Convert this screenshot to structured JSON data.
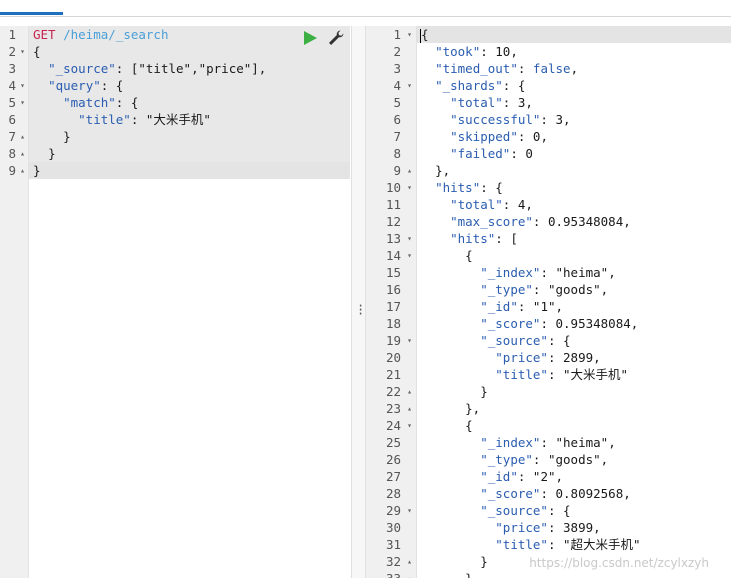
{
  "request": {
    "method": "GET",
    "path": "/heima/_search",
    "lines": [
      {
        "n": "1",
        "fold": "",
        "html": "<span class='m'>GET</span> <span class='u'>/heima/_search</span>"
      },
      {
        "n": "2",
        "fold": "▾",
        "html": "<span class='p'>{</span>"
      },
      {
        "n": "3",
        "fold": "",
        "html": "  <span class='k'>\"_source\"</span><span class='p'>: [</span><span class='s'>\"title\"</span><span class='p'>,</span><span class='s'>\"price\"</span><span class='p'>],</span>"
      },
      {
        "n": "4",
        "fold": "▾",
        "html": "  <span class='k'>\"query\"</span><span class='p'>: {</span>"
      },
      {
        "n": "5",
        "fold": "▾",
        "html": "    <span class='k'>\"match\"</span><span class='p'>: {</span>"
      },
      {
        "n": "6",
        "fold": "",
        "html": "      <span class='k'>\"title\"</span><span class='p'>: </span><span class='s'>\"大米手机\"</span>"
      },
      {
        "n": "7",
        "fold": "▴",
        "html": "    <span class='p'>}</span>"
      },
      {
        "n": "8",
        "fold": "▴",
        "html": "  <span class='p'>}</span>"
      },
      {
        "n": "9",
        "fold": "▴",
        "html": "<span class='p'>}</span>"
      }
    ]
  },
  "response": {
    "lines": [
      {
        "n": "1",
        "fold": "▾",
        "html": "<span class='p'>{</span>"
      },
      {
        "n": "2",
        "fold": "",
        "html": "  <span class='k'>\"took\"</span><span class='p'>: </span><span class='n'>10</span><span class='p'>,</span>"
      },
      {
        "n": "3",
        "fold": "",
        "html": "  <span class='k'>\"timed_out\"</span><span class='p'>: </span><span class='b'>false</span><span class='p'>,</span>"
      },
      {
        "n": "4",
        "fold": "▾",
        "html": "  <span class='k'>\"_shards\"</span><span class='p'>: {</span>"
      },
      {
        "n": "5",
        "fold": "",
        "html": "    <span class='k'>\"total\"</span><span class='p'>: </span><span class='n'>3</span><span class='p'>,</span>"
      },
      {
        "n": "6",
        "fold": "",
        "html": "    <span class='k'>\"successful\"</span><span class='p'>: </span><span class='n'>3</span><span class='p'>,</span>"
      },
      {
        "n": "7",
        "fold": "",
        "html": "    <span class='k'>\"skipped\"</span><span class='p'>: </span><span class='n'>0</span><span class='p'>,</span>"
      },
      {
        "n": "8",
        "fold": "",
        "html": "    <span class='k'>\"failed\"</span><span class='p'>: </span><span class='n'>0</span>"
      },
      {
        "n": "9",
        "fold": "▴",
        "html": "  <span class='p'>},</span>"
      },
      {
        "n": "10",
        "fold": "▾",
        "html": "  <span class='k'>\"hits\"</span><span class='p'>: {</span>"
      },
      {
        "n": "11",
        "fold": "",
        "html": "    <span class='k'>\"total\"</span><span class='p'>: </span><span class='n'>4</span><span class='p'>,</span>"
      },
      {
        "n": "12",
        "fold": "",
        "html": "    <span class='k'>\"max_score\"</span><span class='p'>: </span><span class='n'>0.95348084</span><span class='p'>,</span>"
      },
      {
        "n": "13",
        "fold": "▾",
        "html": "    <span class='k'>\"hits\"</span><span class='p'>: [</span>"
      },
      {
        "n": "14",
        "fold": "▾",
        "html": "      <span class='p'>{</span>"
      },
      {
        "n": "15",
        "fold": "",
        "html": "        <span class='k'>\"_index\"</span><span class='p'>: </span><span class='s'>\"heima\"</span><span class='p'>,</span>"
      },
      {
        "n": "16",
        "fold": "",
        "html": "        <span class='k'>\"_type\"</span><span class='p'>: </span><span class='s'>\"goods\"</span><span class='p'>,</span>"
      },
      {
        "n": "17",
        "fold": "",
        "html": "        <span class='k'>\"_id\"</span><span class='p'>: </span><span class='s'>\"1\"</span><span class='p'>,</span>"
      },
      {
        "n": "18",
        "fold": "",
        "html": "        <span class='k'>\"_score\"</span><span class='p'>: </span><span class='n'>0.95348084</span><span class='p'>,</span>"
      },
      {
        "n": "19",
        "fold": "▾",
        "html": "        <span class='k'>\"_source\"</span><span class='p'>: {</span>"
      },
      {
        "n": "20",
        "fold": "",
        "html": "          <span class='k'>\"price\"</span><span class='p'>: </span><span class='n'>2899</span><span class='p'>,</span>"
      },
      {
        "n": "21",
        "fold": "",
        "html": "          <span class='k'>\"title\"</span><span class='p'>: </span><span class='s'>\"大米手机\"</span>"
      },
      {
        "n": "22",
        "fold": "▴",
        "html": "        <span class='p'>}</span>"
      },
      {
        "n": "23",
        "fold": "▴",
        "html": "      <span class='p'>},</span>"
      },
      {
        "n": "24",
        "fold": "▾",
        "html": "      <span class='p'>{</span>"
      },
      {
        "n": "25",
        "fold": "",
        "html": "        <span class='k'>\"_index\"</span><span class='p'>: </span><span class='s'>\"heima\"</span><span class='p'>,</span>"
      },
      {
        "n": "26",
        "fold": "",
        "html": "        <span class='k'>\"_type\"</span><span class='p'>: </span><span class='s'>\"goods\"</span><span class='p'>,</span>"
      },
      {
        "n": "27",
        "fold": "",
        "html": "        <span class='k'>\"_id\"</span><span class='p'>: </span><span class='s'>\"2\"</span><span class='p'>,</span>"
      },
      {
        "n": "28",
        "fold": "",
        "html": "        <span class='k'>\"_score\"</span><span class='p'>: </span><span class='n'>0.8092568</span><span class='p'>,</span>"
      },
      {
        "n": "29",
        "fold": "▾",
        "html": "        <span class='k'>\"_source\"</span><span class='p'>: {</span>"
      },
      {
        "n": "30",
        "fold": "",
        "html": "          <span class='k'>\"price\"</span><span class='p'>: </span><span class='n'>3899</span><span class='p'>,</span>"
      },
      {
        "n": "31",
        "fold": "",
        "html": "          <span class='k'>\"title\"</span><span class='p'>: </span><span class='s'>\"超大米手机\"</span>"
      },
      {
        "n": "32",
        "fold": "▴",
        "html": "        <span class='p'>}</span>"
      },
      {
        "n": "33",
        "fold": "▴",
        "html": "      <span class='p'>},</span>"
      }
    ]
  },
  "watermark": "https://blog.csdn.net/zcylxzyh",
  "icons": {
    "run": "play-icon",
    "settings": "wrench-icon",
    "splitter": "vertical-dots-icon"
  },
  "colors": {
    "run": "#3cb043",
    "key": "#2a5db0",
    "method": "#c7254e",
    "path": "#4a9fd8"
  }
}
